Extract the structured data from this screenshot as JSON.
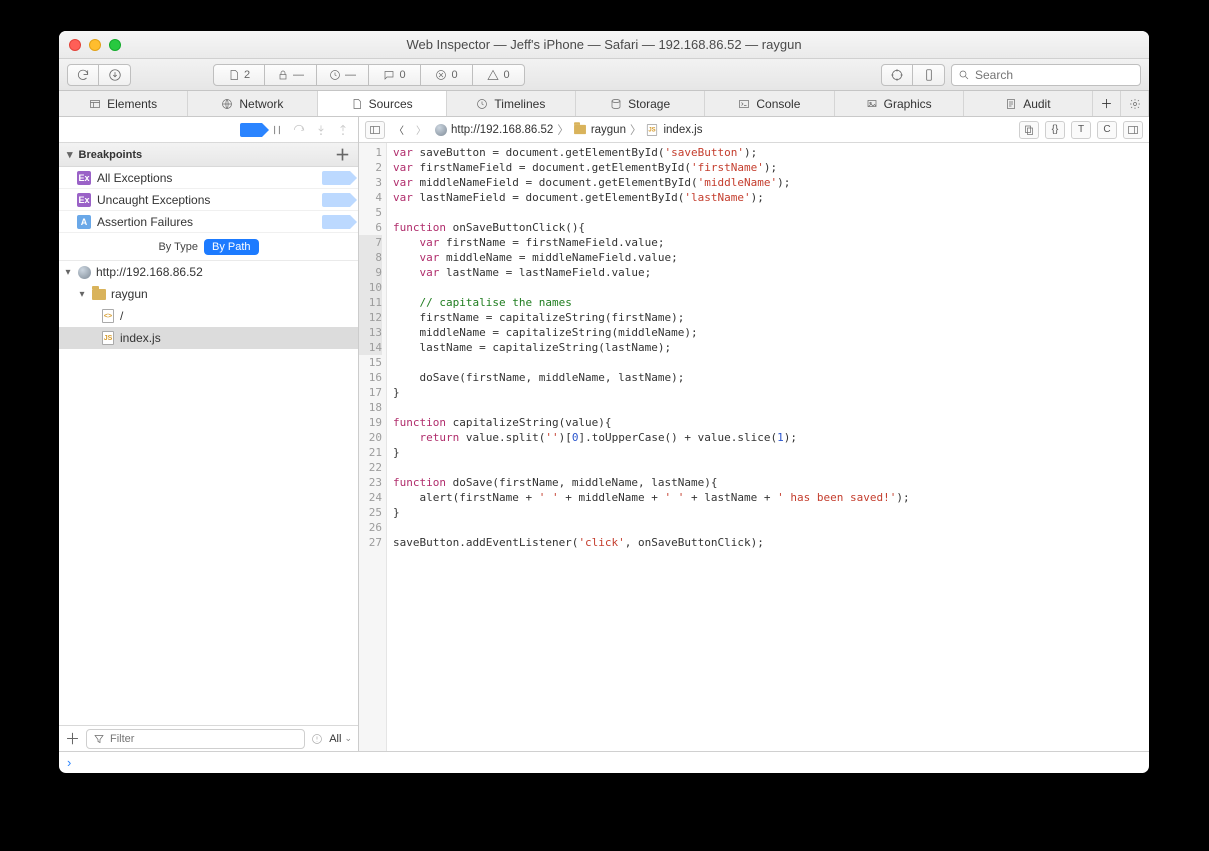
{
  "window": {
    "title": "Web Inspector — Jeff's iPhone — Safari — 192.168.86.52 — raygun"
  },
  "toolbar": {
    "doc_count": "2",
    "lock_count": "—",
    "time_count": "—",
    "chat_count": "0",
    "bug_count": "0",
    "warn_count": "0",
    "search_placeholder": "Search"
  },
  "tabs": {
    "items": [
      {
        "label": "Elements"
      },
      {
        "label": "Network"
      },
      {
        "label": "Sources"
      },
      {
        "label": "Timelines"
      },
      {
        "label": "Storage"
      },
      {
        "label": "Console"
      },
      {
        "label": "Graphics"
      },
      {
        "label": "Audit"
      }
    ],
    "active_index": 2
  },
  "breakpoints": {
    "heading": "Breakpoints",
    "items": [
      {
        "label": "All Exceptions"
      },
      {
        "label": "Uncaught Exceptions"
      },
      {
        "label": "Assertion Failures"
      }
    ],
    "view_type_label": "By Type",
    "view_path_label": "By Path"
  },
  "tree": {
    "host": "http://192.168.86.52",
    "folder": "raygun",
    "root_doc": "/",
    "file": "index.js"
  },
  "filter": {
    "placeholder": "Filter",
    "scope": "All"
  },
  "crumbs": {
    "host": "http://192.168.86.52",
    "folder": "raygun",
    "file": "index.js"
  },
  "code": {
    "lines": [
      [
        [
          "kw",
          "var"
        ],
        [
          "",
          " saveButton = document.getElementById("
        ],
        [
          "str",
          "'saveButton'"
        ],
        [
          "",
          ");"
        ]
      ],
      [
        [
          "kw",
          "var"
        ],
        [
          "",
          " firstNameField = document.getElementById("
        ],
        [
          "str",
          "'firstName'"
        ],
        [
          "",
          ");"
        ]
      ],
      [
        [
          "kw",
          "var"
        ],
        [
          "",
          " middleNameField = document.getElementById("
        ],
        [
          "str",
          "'middleName'"
        ],
        [
          "",
          ");"
        ]
      ],
      [
        [
          "kw",
          "var"
        ],
        [
          "",
          " lastNameField = document.getElementById("
        ],
        [
          "str",
          "'lastName'"
        ],
        [
          "",
          ");"
        ]
      ],
      [],
      [
        [
          "kw",
          "function"
        ],
        [
          "",
          " onSaveButtonClick(){"
        ]
      ],
      [
        [
          "",
          "    "
        ],
        [
          "kw",
          "var"
        ],
        [
          "",
          " firstName = firstNameField.value;"
        ]
      ],
      [
        [
          "",
          "    "
        ],
        [
          "kw",
          "var"
        ],
        [
          "",
          " middleName = middleNameField.value;"
        ]
      ],
      [
        [
          "",
          "    "
        ],
        [
          "kw",
          "var"
        ],
        [
          "",
          " lastName = lastNameField.value;"
        ]
      ],
      [],
      [
        [
          "",
          "    "
        ],
        [
          "cm",
          "// capitalise the names"
        ]
      ],
      [
        [
          "",
          "    firstName = capitalizeString(firstName);"
        ]
      ],
      [
        [
          "",
          "    middleName = capitalizeString(middleName);"
        ]
      ],
      [
        [
          "",
          "    lastName = capitalizeString(lastName);"
        ]
      ],
      [],
      [
        [
          "",
          "    doSave(firstName, middleName, lastName);"
        ]
      ],
      [
        [
          "",
          "}"
        ]
      ],
      [],
      [
        [
          "kw",
          "function"
        ],
        [
          "",
          " capitalizeString(value){"
        ]
      ],
      [
        [
          "",
          "    "
        ],
        [
          "kw",
          "return"
        ],
        [
          "",
          " value.split("
        ],
        [
          "str",
          "''"
        ],
        [
          "",
          ")["
        ],
        [
          "num",
          "0"
        ],
        [
          "",
          "].toUpperCase() + value.slice("
        ],
        [
          "num",
          "1"
        ],
        [
          "",
          ");"
        ]
      ],
      [
        [
          "",
          "}"
        ]
      ],
      [],
      [
        [
          "kw",
          "function"
        ],
        [
          "",
          " doSave(firstName, middleName, lastName){"
        ]
      ],
      [
        [
          "",
          "    alert(firstName + "
        ],
        [
          "str",
          "' '"
        ],
        [
          "",
          " + middleName + "
        ],
        [
          "str",
          "' '"
        ],
        [
          "",
          " + lastName + "
        ],
        [
          "str",
          "' has been saved!'"
        ],
        [
          "",
          ");"
        ]
      ],
      [
        [
          "",
          "}"
        ]
      ],
      [],
      [
        [
          "",
          "saveButton.addEventListener("
        ],
        [
          "str",
          "'click'"
        ],
        [
          "",
          ", onSaveButtonClick);"
        ]
      ]
    ]
  },
  "console": {
    "prompt": "›"
  }
}
